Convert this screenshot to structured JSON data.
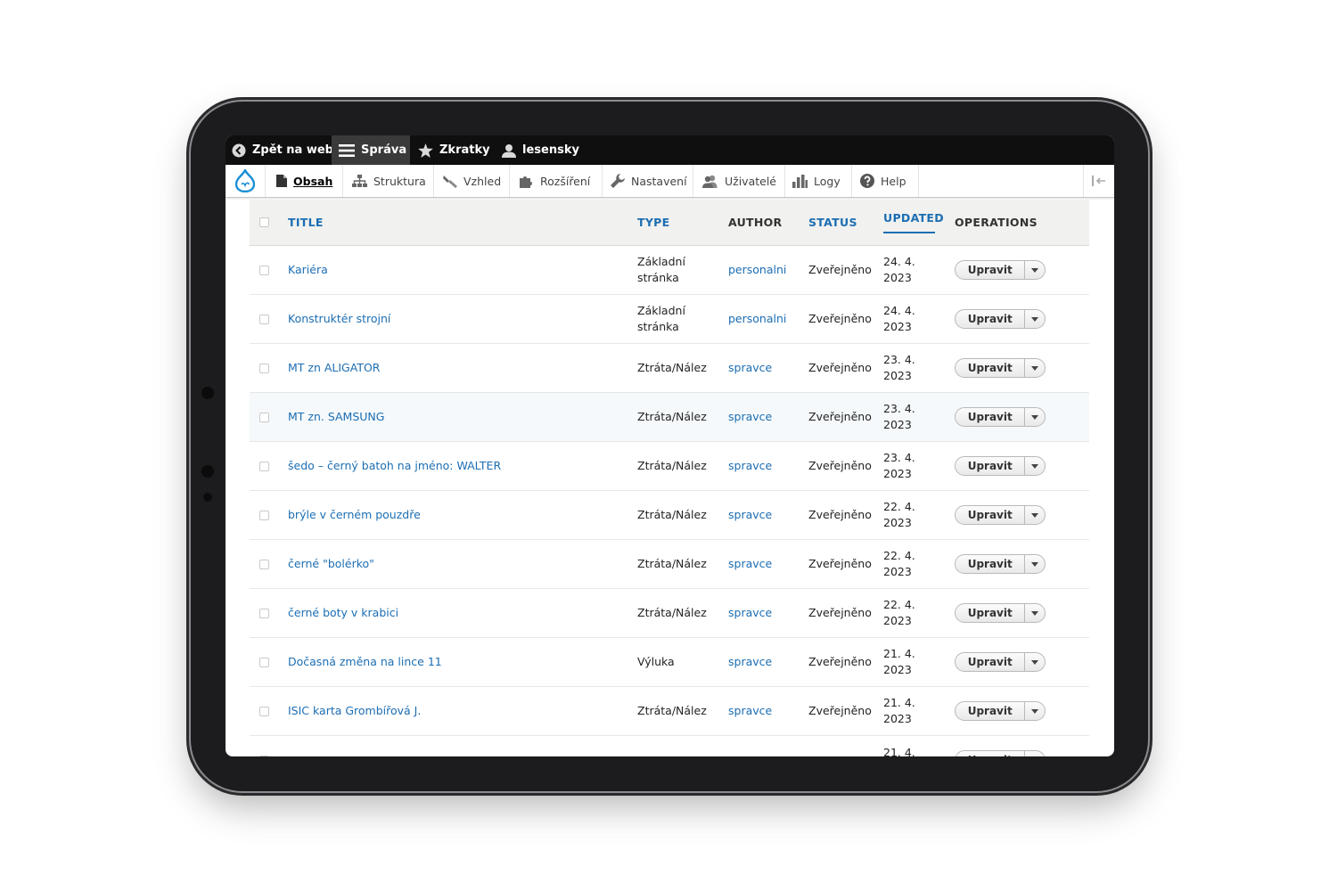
{
  "toolbar": {
    "back_label": "Zpět na web",
    "manage_label": "Správa",
    "shortcuts_label": "Zkratky",
    "user_label": "lesensky"
  },
  "tray": {
    "items": [
      {
        "label": "Obsah",
        "icon": "document-icon"
      },
      {
        "label": "Struktura",
        "icon": "sitemap-icon"
      },
      {
        "label": "Vzhled",
        "icon": "paintbrush-icon"
      },
      {
        "label": "Rozšíření",
        "icon": "puzzle-icon"
      },
      {
        "label": "Nastavení",
        "icon": "wrench-icon"
      },
      {
        "label": "Uživatelé",
        "icon": "people-icon"
      },
      {
        "label": "Logy",
        "icon": "bar-chart-icon"
      },
      {
        "label": "Help",
        "icon": "help-icon"
      }
    ]
  },
  "table": {
    "headers": {
      "title": "TITLE",
      "type": "TYPE",
      "author": "AUTHOR",
      "status": "STATUS",
      "updated": "UPDATED",
      "operations": "OPERATIONS"
    },
    "edit_label": "Upravit",
    "rows": [
      {
        "title": "Kariéra",
        "type": "Základní stránka",
        "author": "personalni",
        "status": "Zveřejněno",
        "updated": "24. 4. 2023"
      },
      {
        "title": "Konstruktér strojní",
        "type": "Základní stránka",
        "author": "personalni",
        "status": "Zveřejněno",
        "updated": "24. 4. 2023"
      },
      {
        "title": "MT zn ALIGATOR",
        "type": "Ztráta/Nález",
        "author": "spravce",
        "status": "Zveřejněno",
        "updated": "23. 4. 2023"
      },
      {
        "title": "MT zn. SAMSUNG",
        "type": "Ztráta/Nález",
        "author": "spravce",
        "status": "Zveřejněno",
        "updated": "23. 4. 2023"
      },
      {
        "title": "šedo – černý batoh na jméno: WALTER",
        "type": "Ztráta/Nález",
        "author": "spravce",
        "status": "Zveřejněno",
        "updated": "23. 4. 2023"
      },
      {
        "title": "brýle v černém pouzdře",
        "type": "Ztráta/Nález",
        "author": "spravce",
        "status": "Zveřejněno",
        "updated": "22. 4. 2023"
      },
      {
        "title": "černé \"bolérko\"",
        "type": "Ztráta/Nález",
        "author": "spravce",
        "status": "Zveřejněno",
        "updated": "22. 4. 2023"
      },
      {
        "title": "černé boty v krabici",
        "type": "Ztráta/Nález",
        "author": "spravce",
        "status": "Zveřejněno",
        "updated": "22. 4. 2023"
      },
      {
        "title": "Dočasná změna na lince 11",
        "type": "Výluka",
        "author": "spravce",
        "status": "Zveřejněno",
        "updated": "21. 4. 2023"
      },
      {
        "title": "ISIC karta Grombířová J.",
        "type": "Ztráta/Nález",
        "author": "spravce",
        "status": "Zveřejněno",
        "updated": "21. 4. 2023"
      },
      {
        "title": "",
        "type": "",
        "author": "",
        "status": "",
        "updated": "21. 4."
      }
    ]
  }
}
